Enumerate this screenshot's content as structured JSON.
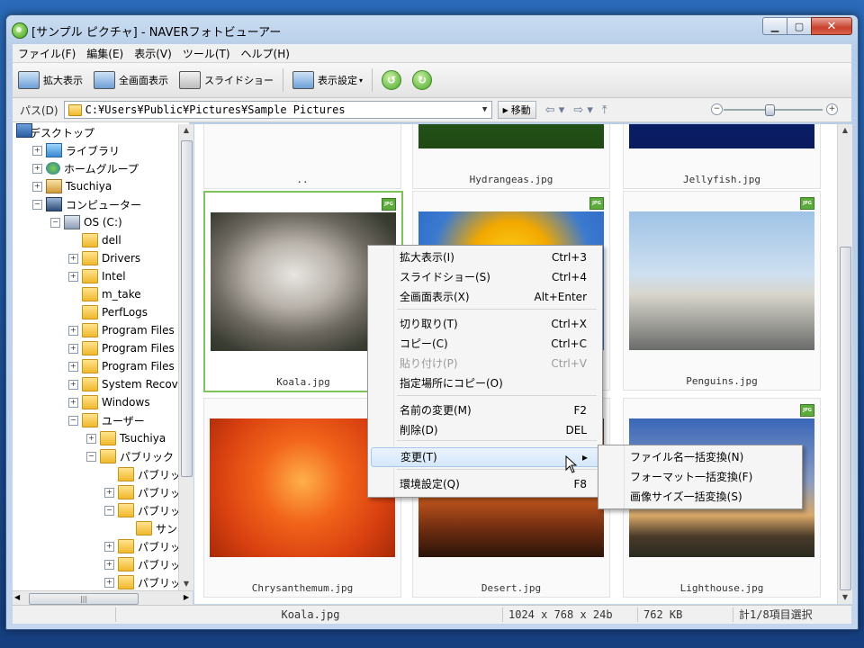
{
  "window": {
    "title": "[サンプル ピクチャ] - NAVERフォトビューアー"
  },
  "menubar": [
    "ファイル(F)",
    "編集(E)",
    "表示(V)",
    "ツール(T)",
    "ヘルプ(H)"
  ],
  "toolbar": {
    "zoom_view": "拡大表示",
    "fullscreen": "全画面表示",
    "slideshow": "スライドショー",
    "view_settings": "表示設定"
  },
  "pathbar": {
    "label": "パス(D)",
    "path": "C:¥Users¥Public¥Pictures¥Sample Pictures",
    "move_button": "移動"
  },
  "tree": [
    {
      "label": "デスクトップ",
      "icon": "desktop-icon",
      "exp": "minus"
    },
    {
      "label": "ライブラリ",
      "icon": "library-icon",
      "exp": "plus"
    },
    {
      "label": "ホームグループ",
      "icon": "homegroup-icon",
      "exp": "plus"
    },
    {
      "label": "Tsuchiya",
      "icon": "user-folder-icon",
      "exp": "plus"
    },
    {
      "label": "コンピューター",
      "icon": "computer-icon",
      "exp": "minus"
    },
    {
      "label": "OS (C:)",
      "icon": "drive-icon",
      "exp": "minus"
    },
    {
      "label": "dell",
      "icon": "folder-icon",
      "exp": ""
    },
    {
      "label": "Drivers",
      "icon": "folder-icon",
      "exp": "plus"
    },
    {
      "label": "Intel",
      "icon": "folder-icon",
      "exp": "plus"
    },
    {
      "label": "m_take",
      "icon": "folder-icon",
      "exp": ""
    },
    {
      "label": "PerfLogs",
      "icon": "folder-icon",
      "exp": ""
    },
    {
      "label": "Program Files",
      "icon": "folder-icon",
      "exp": "plus"
    },
    {
      "label": "Program Files",
      "icon": "folder-icon",
      "exp": "plus"
    },
    {
      "label": "Program Files",
      "icon": "folder-icon",
      "exp": "plus"
    },
    {
      "label": "System Recov",
      "icon": "folder-icon",
      "exp": "plus"
    },
    {
      "label": "Windows",
      "icon": "folder-icon",
      "exp": "plus"
    },
    {
      "label": "ユーザー",
      "icon": "folder-icon",
      "exp": "minus"
    },
    {
      "label": "Tsuchiya",
      "icon": "folder-icon",
      "exp": "plus"
    },
    {
      "label": "パブリック",
      "icon": "folder-icon",
      "exp": "minus"
    },
    {
      "label": "パブリッ",
      "icon": "folder-icon",
      "exp": ""
    },
    {
      "label": "パブリッ",
      "icon": "folder-icon",
      "exp": "plus"
    },
    {
      "label": "パブリッ",
      "icon": "folder-icon",
      "exp": "minus"
    },
    {
      "label": "サン",
      "icon": "folder-icon",
      "exp": ""
    },
    {
      "label": "パブリッ",
      "icon": "folder-icon",
      "exp": "plus"
    },
    {
      "label": "パブリッ",
      "icon": "folder-icon",
      "exp": "plus"
    },
    {
      "label": "パブリッ",
      "icon": "folder-icon",
      "exp": "plus"
    }
  ],
  "thumbnails": [
    {
      "caption": "..",
      "badge": ""
    },
    {
      "caption": "Hydrangeas.jpg",
      "badge": ""
    },
    {
      "caption": "Jellyfish.jpg",
      "badge": ""
    },
    {
      "caption": "Koala.jpg",
      "badge": "JPG",
      "selected": true
    },
    {
      "caption": "",
      "badge": "JPG"
    },
    {
      "caption": "Penguins.jpg",
      "badge": "JPG"
    },
    {
      "caption": "Chrysanthemum.jpg",
      "badge": ""
    },
    {
      "caption": "Desert.jpg",
      "badge": ""
    },
    {
      "caption": "Lighthouse.jpg",
      "badge": "JPG"
    }
  ],
  "context_menu": [
    {
      "label": "拡大表示(I)",
      "key": "Ctrl+3"
    },
    {
      "label": "スライドショー(S)",
      "key": "Ctrl+4"
    },
    {
      "label": "全画面表示(X)",
      "key": "Alt+Enter"
    },
    {
      "label": "切り取り(T)",
      "key": "Ctrl+X"
    },
    {
      "label": "コピー(C)",
      "key": "Ctrl+C"
    },
    {
      "label": "貼り付け(P)",
      "key": "Ctrl+V",
      "disabled": true
    },
    {
      "label": "指定場所にコピー(O)",
      "key": ""
    },
    {
      "label": "名前の変更(M)",
      "key": "F2"
    },
    {
      "label": "削除(D)",
      "key": "DEL"
    },
    {
      "label": "変更(T)",
      "key": "",
      "submenu": true,
      "highlighted": true
    },
    {
      "label": "環境設定(Q)",
      "key": "F8"
    }
  ],
  "submenu": [
    "ファイル名一括変換(N)",
    "フォーマット一括変換(F)",
    "画像サイズ一括変換(S)"
  ],
  "statusbar": {
    "filename": "Koala.jpg",
    "dimensions": "1024 x 768 x 24b",
    "size": "762 KB",
    "selection": "計1/8項目選択"
  },
  "colors": {
    "selection_border": "#7cc45a",
    "titlebar": "#c9dcf1",
    "jpg_badge": "#5cab3c"
  }
}
